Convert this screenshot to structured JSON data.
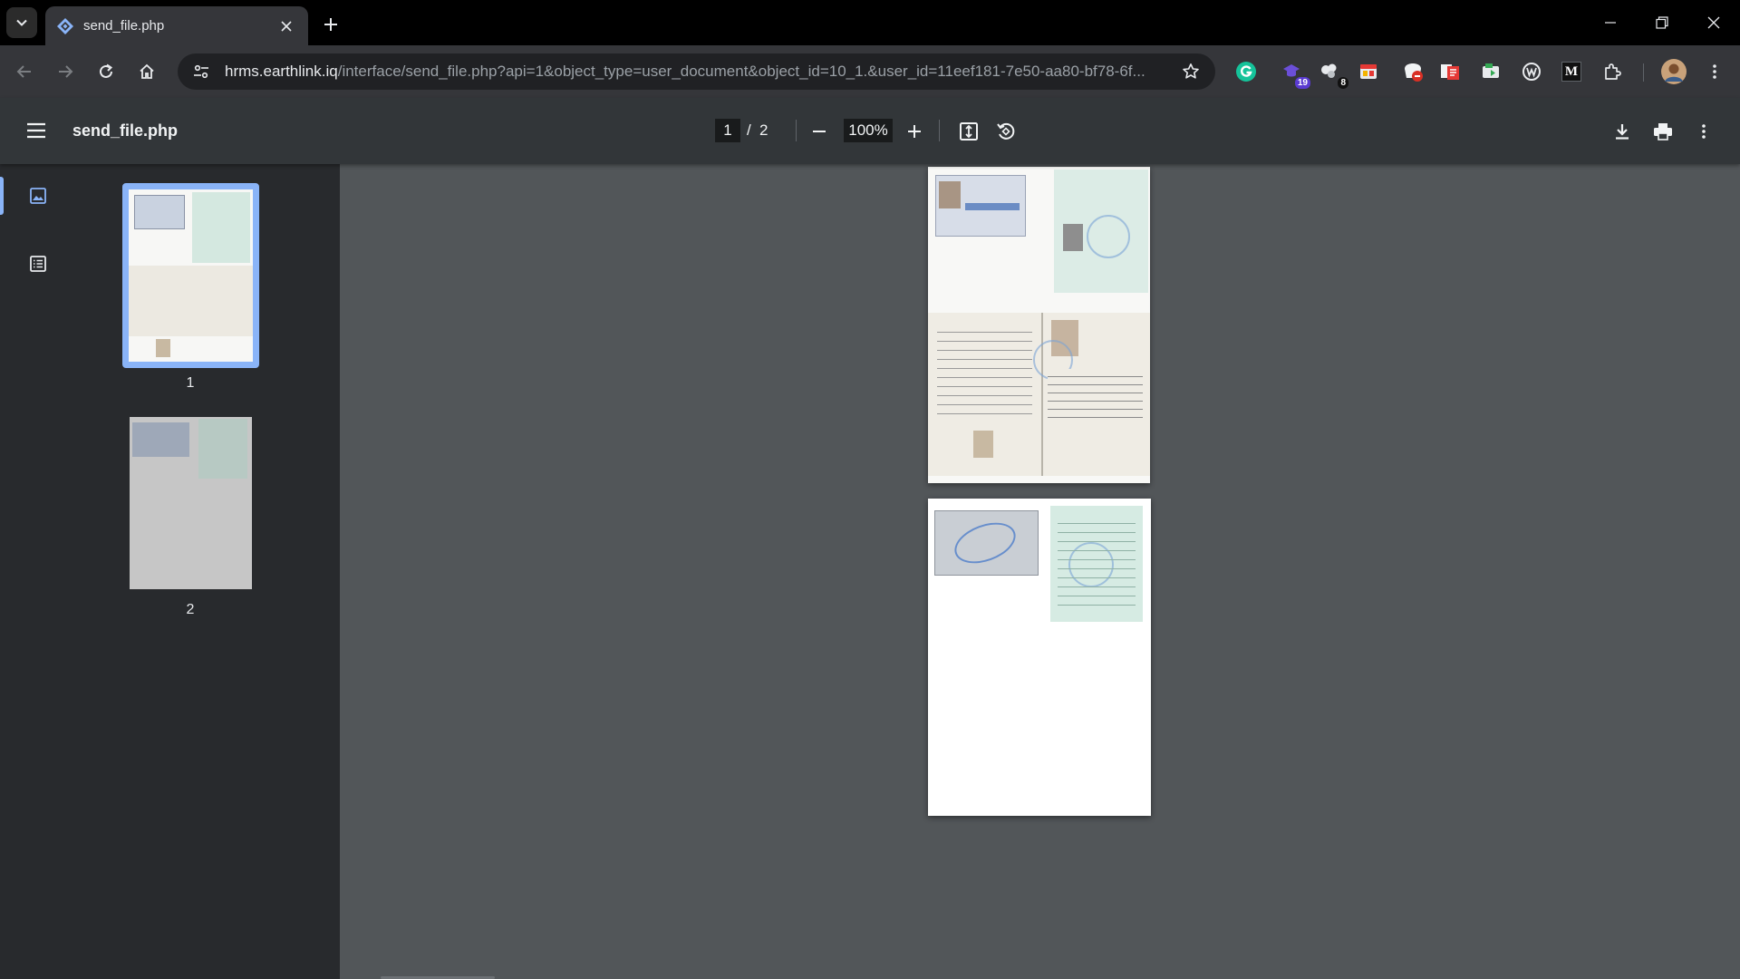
{
  "browser": {
    "tab": {
      "title": "send_file.php"
    },
    "url": {
      "host": "hrms.earthlink.iq",
      "path": "/interface/send_file.php?api=1&object_type=user_document&object_id=10_1.&user_id=11eef181-7e50-aa80-bf78-6f..."
    },
    "extensions": [
      {
        "name": "grammarly-icon",
        "badge": ""
      },
      {
        "name": "extension-icon",
        "badge": "19"
      },
      {
        "name": "extension-icon",
        "badge": "8"
      },
      {
        "name": "extension-icon",
        "badge": ""
      },
      {
        "name": "extension-icon",
        "badge": ""
      },
      {
        "name": "extension-icon",
        "badge": ""
      },
      {
        "name": "extension-icon",
        "badge": ""
      },
      {
        "name": "extension-icon",
        "badge": ""
      },
      {
        "name": "medium-icon",
        "label": "M"
      }
    ]
  },
  "pdf_viewer": {
    "filename": "send_file.php",
    "current_page": "1",
    "page_separator": "/",
    "total_pages": "2",
    "zoom": "100%",
    "thumbnails": [
      {
        "label": "1"
      },
      {
        "label": "2"
      }
    ]
  },
  "colors": {
    "accent": "#8ab4f8",
    "tab_bg": "#35363a",
    "pdf_toolbar": "#323639",
    "sidebar": "#282a2d",
    "canvas": "#525659"
  }
}
